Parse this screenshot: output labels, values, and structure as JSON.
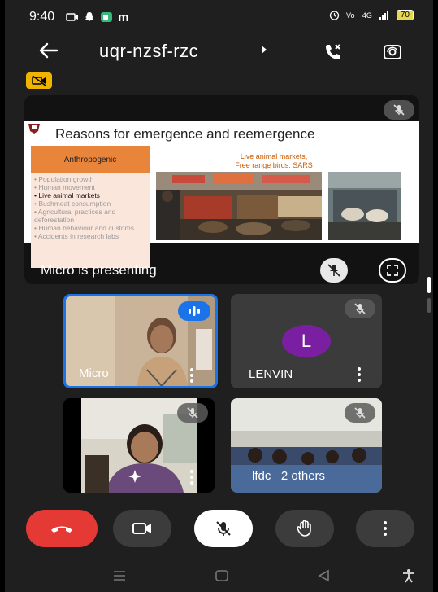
{
  "status_bar": {
    "time": "9:40",
    "app_indicator": "m",
    "network": "4G",
    "battery": "70"
  },
  "top_bar": {
    "meeting_code": "uqr-nzsf-rzc"
  },
  "presentation": {
    "slide_title": "Reasons for emergence and reemergence",
    "category_label": "Anthropogenic",
    "reasons": [
      "Population growth",
      "Human movement",
      "Live animal markets",
      "Bushmeat consumption",
      "Agricultural practices and deforestation",
      "Human behaviour and customs",
      "Accidents in research labs"
    ],
    "highlighted_reason": "Live animal markets",
    "photo_caption_line1": "Live animal markets,",
    "photo_caption_line2": "Free range birds: SARS",
    "presenter_status": "Micro is presenting"
  },
  "participants": [
    {
      "name": "Micro",
      "speaking": true
    },
    {
      "name": "LENVIN",
      "initial": "L",
      "avatar_color": "#7b1fa2",
      "muted": true
    },
    {
      "name": "",
      "muted": true
    },
    {
      "name": "lfdc   2 others",
      "muted": true
    }
  ],
  "colors": {
    "end_call": "#e53935",
    "control_bg": "#3c3c3c",
    "speaking_border": "#1a73e8",
    "badge": "#f0b400"
  },
  "icons": [
    "back-arrow-icon",
    "phone-audio-icon",
    "switch-camera-icon",
    "video-off-badge-icon",
    "mic-off-icon",
    "fullscreen-icon",
    "more-vertical-icon",
    "raise-hand-icon",
    "end-call-icon",
    "video-camera-icon",
    "sparkle-effects-icon"
  ]
}
